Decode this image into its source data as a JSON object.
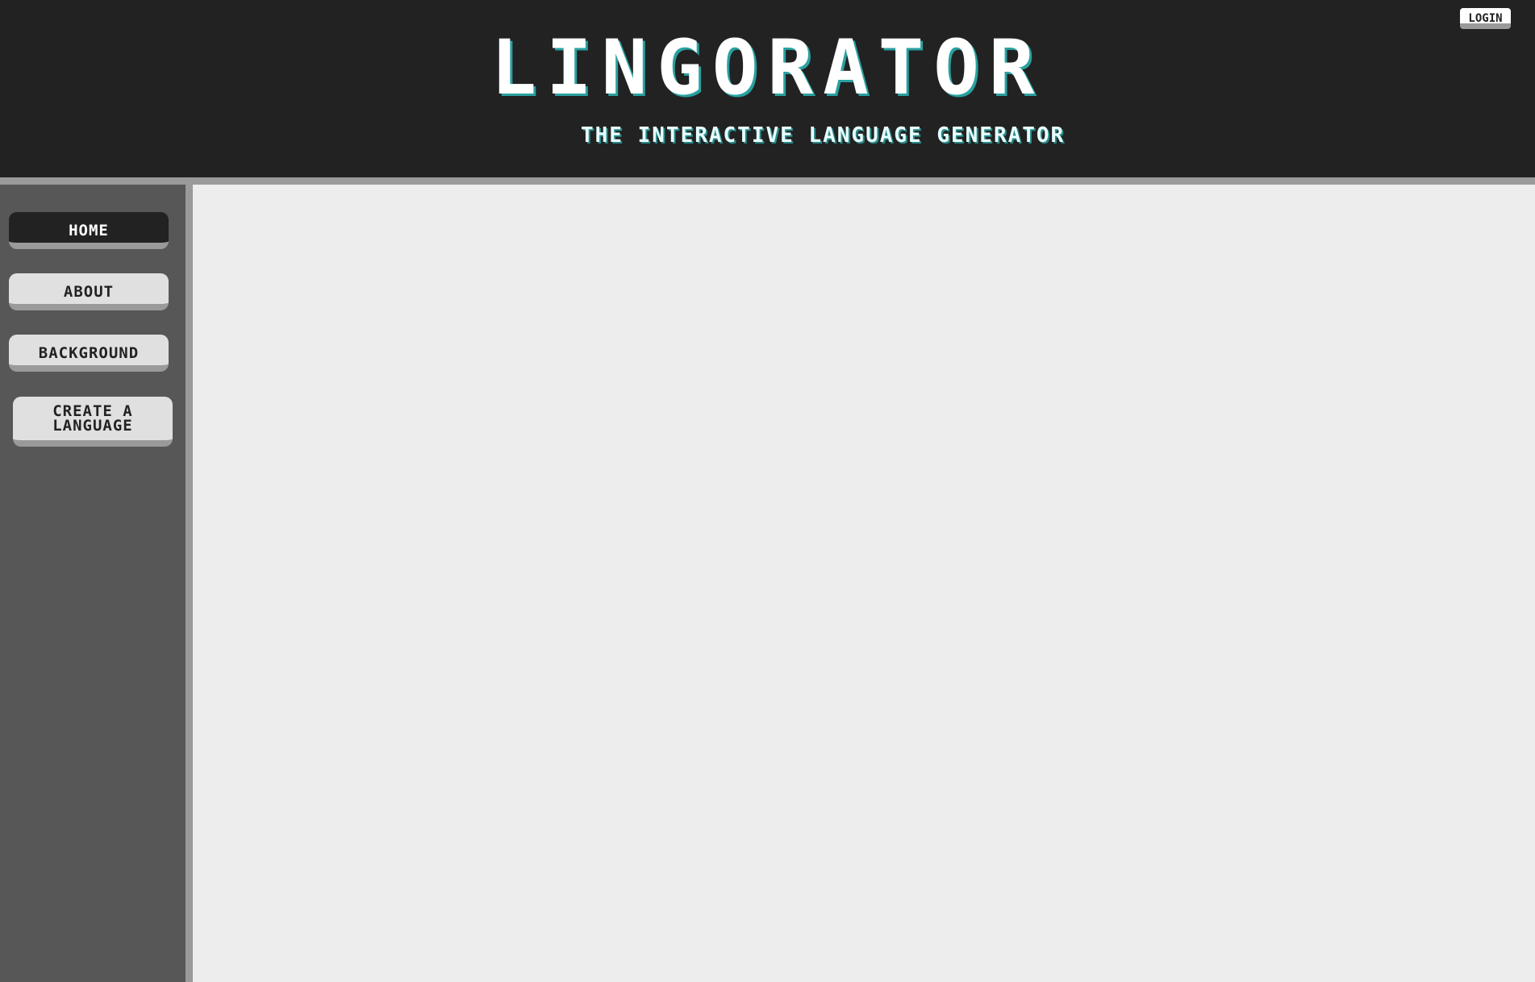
{
  "header": {
    "title": "LINGORATOR",
    "subtitle": "THE INTERACTIVE LANGUAGE GENERATOR",
    "login_label": "LOGIN"
  },
  "sidebar": {
    "items": [
      {
        "label": "HOME",
        "active": true
      },
      {
        "label": "ABOUT",
        "active": false
      },
      {
        "label": "BACKGROUND",
        "active": false
      },
      {
        "label": "CREATE A\nLANGUAGE",
        "active": false
      }
    ]
  },
  "colors": {
    "header_bg": "#222222",
    "accent_shadow": "#2aa0a0",
    "sidebar_bg": "#575757",
    "border_gray": "#9a9a9a",
    "button_bg": "#e0e0e0",
    "main_bg": "#ededed"
  }
}
